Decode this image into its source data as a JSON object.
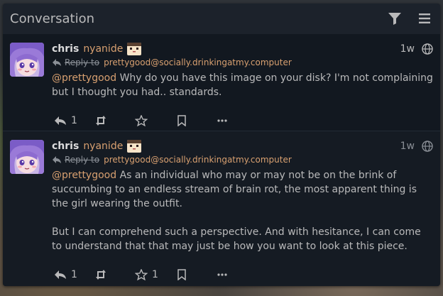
{
  "header": {
    "title": "Conversation",
    "filter_icon": "filter-icon",
    "menu_icon": "menu-icon"
  },
  "posts": [
    {
      "name": "chris",
      "handle": "nyanide",
      "time": "1w",
      "reply_label": "Reply to",
      "reply_target": "prettygood@socially.drinkingatmy.computer",
      "mention": "@prettygood",
      "text": " Why do you have this image on your disk? I'm not complaining but I thought you had.. standards.",
      "reply_count": "1",
      "favorite_count": ""
    },
    {
      "name": "chris",
      "handle": "nyanide",
      "time": "1w",
      "reply_label": "Reply to",
      "reply_target": "prettygood@socially.drinkingatmy.computer",
      "mention": "@prettygood",
      "text": " As an individual who may or may not be on the brink of succumbing to an endless stream of brain rot, the most apparent thing is the girl wearing the outfit.",
      "text2": "But I can comprehend such a perspective. And with hesitance, I can come to understand that that may just be how you want to look at this piece.",
      "reply_count": "1",
      "favorite_count": "1"
    }
  ],
  "colors": {
    "accent": "#d8a070",
    "text": "#b9b9ba",
    "panel": "#121820"
  }
}
